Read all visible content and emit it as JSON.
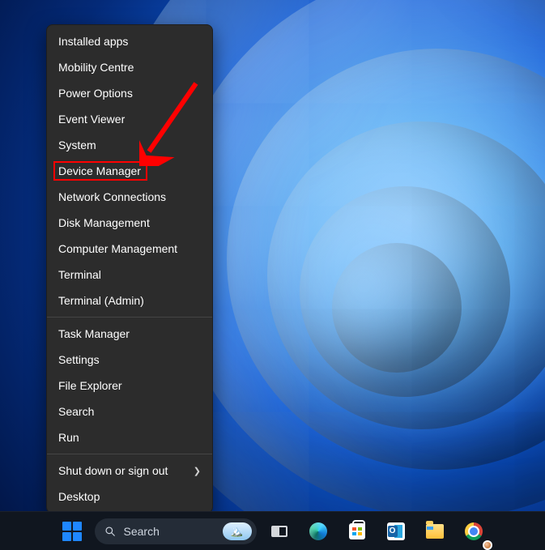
{
  "menu": {
    "groups": [
      [
        {
          "id": "installed-apps",
          "label": "Installed apps"
        },
        {
          "id": "mobility-centre",
          "label": "Mobility Centre"
        },
        {
          "id": "power-options",
          "label": "Power Options"
        },
        {
          "id": "event-viewer",
          "label": "Event Viewer"
        },
        {
          "id": "system",
          "label": "System"
        },
        {
          "id": "device-manager",
          "label": "Device Manager",
          "highlighted": true
        },
        {
          "id": "network-connections",
          "label": "Network Connections"
        },
        {
          "id": "disk-management",
          "label": "Disk Management"
        },
        {
          "id": "computer-management",
          "label": "Computer Management"
        },
        {
          "id": "terminal",
          "label": "Terminal"
        },
        {
          "id": "terminal-admin",
          "label": "Terminal (Admin)"
        }
      ],
      [
        {
          "id": "task-manager",
          "label": "Task Manager"
        },
        {
          "id": "settings",
          "label": "Settings"
        },
        {
          "id": "file-explorer",
          "label": "File Explorer"
        },
        {
          "id": "search",
          "label": "Search"
        },
        {
          "id": "run",
          "label": "Run"
        }
      ],
      [
        {
          "id": "shut-down-or-sign-out",
          "label": "Shut down or sign out",
          "submenu": true
        },
        {
          "id": "desktop",
          "label": "Desktop"
        }
      ]
    ]
  },
  "annotation": {
    "target_id": "device-manager",
    "color": "#ff0000"
  },
  "taskbar": {
    "search_label": "Search",
    "items": [
      {
        "id": "start",
        "name": "start-button"
      },
      {
        "id": "search",
        "name": "taskbar-search"
      },
      {
        "id": "task-view",
        "name": "task-view-button"
      },
      {
        "id": "edge",
        "name": "edge-button"
      },
      {
        "id": "ms-store",
        "name": "microsoft-store-button"
      },
      {
        "id": "outlook",
        "name": "outlook-button"
      },
      {
        "id": "file-explorer",
        "name": "file-explorer-button"
      },
      {
        "id": "chrome",
        "name": "chrome-button"
      }
    ]
  }
}
